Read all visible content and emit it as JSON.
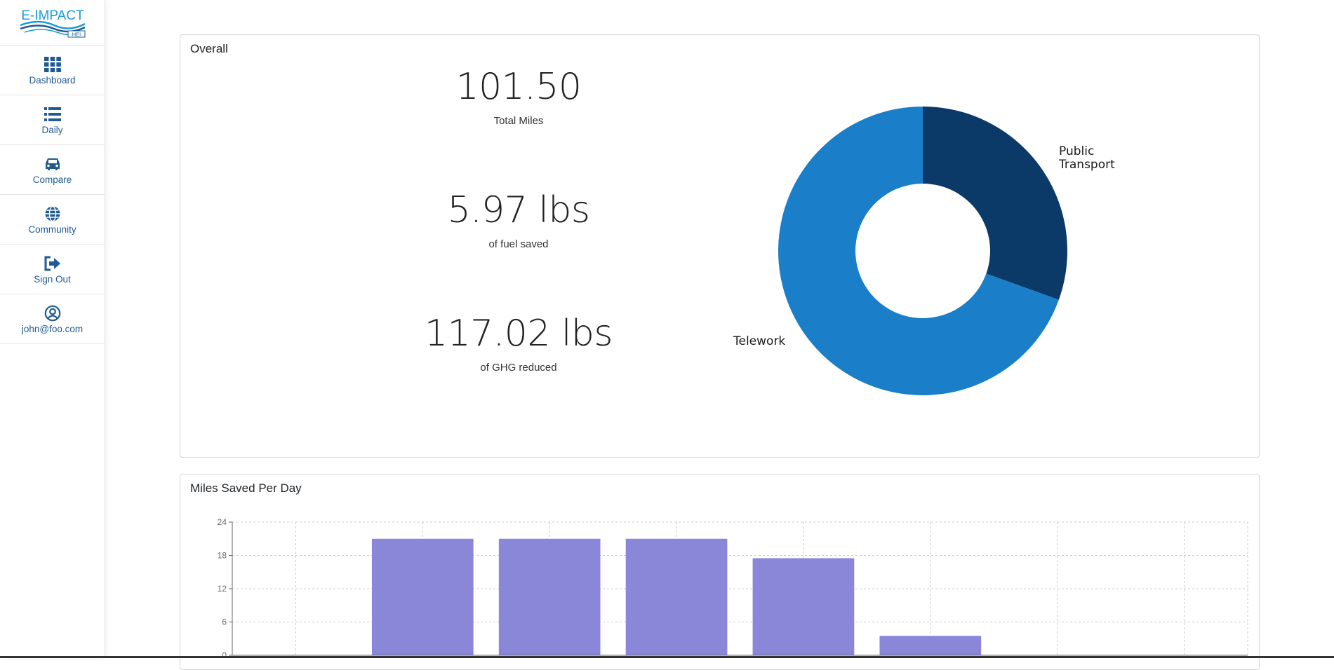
{
  "app": {
    "logo_text": "E-IMPACT",
    "logo_sub": "HEI"
  },
  "sidebar": {
    "items": [
      {
        "label": "Dashboard",
        "icon": "grid-icon"
      },
      {
        "label": "Daily",
        "icon": "list-icon"
      },
      {
        "label": "Compare",
        "icon": "car-icon"
      },
      {
        "label": "Community",
        "icon": "globe-icon"
      },
      {
        "label": "Sign Out",
        "icon": "sign-out-icon"
      },
      {
        "label": "john@foo.com",
        "icon": "user-circle-icon"
      }
    ]
  },
  "overall": {
    "title": "Overall",
    "stats": [
      {
        "value": "101.50",
        "label": "Total Miles"
      },
      {
        "value": "5.97 lbs",
        "label": "of fuel saved"
      },
      {
        "value": "117.02 lbs",
        "label": "of GHG reduced"
      }
    ]
  },
  "miles_per_day": {
    "title": "Miles Saved Per Day"
  },
  "colors": {
    "sidebar_text": "#1f5a93",
    "donut_public_transport": "#0b3a68",
    "donut_telework": "#1a7fc8",
    "bar_fill": "#8a87d8"
  },
  "chart_data": [
    {
      "type": "pie",
      "donut": true,
      "labels": [
        "Public Transport",
        "Telework"
      ],
      "values": [
        30.5,
        69.5
      ]
    },
    {
      "type": "bar",
      "categories": [
        "",
        "",
        "",
        "",
        "",
        "",
        "",
        ""
      ],
      "values": [
        0,
        21,
        21,
        21,
        17.5,
        3.5,
        0,
        0
      ],
      "ylim": [
        0,
        24
      ],
      "yticks": [
        "0",
        "6",
        "12",
        "18",
        "24"
      ],
      "grid": true
    }
  ]
}
